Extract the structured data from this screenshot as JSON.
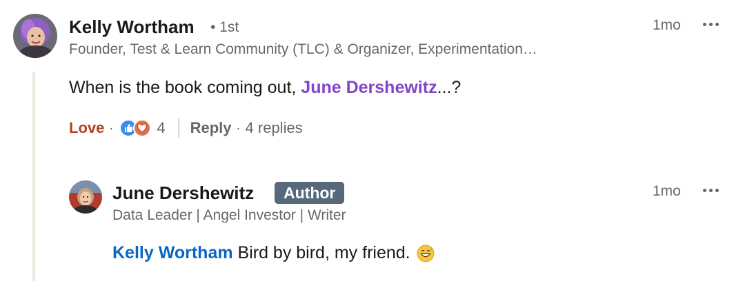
{
  "comment": {
    "author": {
      "name": "Kelly Wortham",
      "degree": "• 1st",
      "headline": "Founder, Test & Learn Community (TLC) & Organizer, Experimentation…",
      "avatar_icon": "profile-photo-icon"
    },
    "time": "1mo",
    "more_icon": "ellipsis-icon",
    "text": {
      "before": "When is the book coming out, ",
      "mention": "June Dershewitz",
      "after": "...?"
    },
    "actions": {
      "love_label": "Love",
      "reaction_count": "4",
      "reply_label": "Reply",
      "replies_label": "4 replies"
    },
    "colors": {
      "love": "#b24020",
      "mention": "#8344cc",
      "thread_line": "#ede6dc"
    }
  },
  "reply": {
    "author": {
      "name": "June Dershewitz",
      "badge": "Author",
      "headline": "Data Leader | Angel Investor | Writer",
      "avatar_icon": "profile-photo-icon"
    },
    "time": "1mo",
    "more_icon": "ellipsis-icon",
    "text": {
      "mention": "Kelly Wortham",
      "after": " Bird by bird, my friend. ",
      "emoji": "grinning-sweat-emoji"
    },
    "colors": {
      "mention": "#0a66c2",
      "badge": "#56687a"
    }
  }
}
